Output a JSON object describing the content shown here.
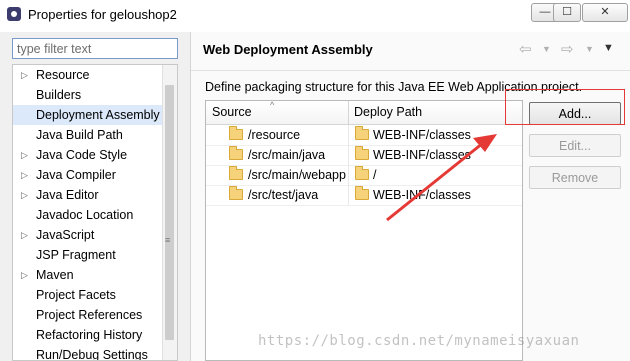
{
  "window": {
    "title": "Properties for geloushop2",
    "minimize": "—",
    "maximize": "☐",
    "close": "✕"
  },
  "filter": {
    "placeholder": "type filter text"
  },
  "tree": {
    "items": [
      {
        "label": "Resource",
        "expandable": true
      },
      {
        "label": "Builders",
        "expandable": false
      },
      {
        "label": "Deployment Assembly",
        "expandable": false,
        "selected": true
      },
      {
        "label": "Java Build Path",
        "expandable": false
      },
      {
        "label": "Java Code Style",
        "expandable": true
      },
      {
        "label": "Java Compiler",
        "expandable": true
      },
      {
        "label": "Java Editor",
        "expandable": true
      },
      {
        "label": "Javadoc Location",
        "expandable": false
      },
      {
        "label": "JavaScript",
        "expandable": true
      },
      {
        "label": "JSP Fragment",
        "expandable": false
      },
      {
        "label": "Maven",
        "expandable": true
      },
      {
        "label": "Project Facets",
        "expandable": false
      },
      {
        "label": "Project References",
        "expandable": false
      },
      {
        "label": "Refactoring History",
        "expandable": false
      },
      {
        "label": "Run/Debug Settings",
        "expandable": false
      }
    ]
  },
  "panel": {
    "title": "Web Deployment Assembly",
    "description": "Define packaging structure for this Java EE Web Application project.",
    "nav": {
      "back": "⇦",
      "forward": "⇨",
      "dropdown": "▼",
      "menu": "▼"
    }
  },
  "table": {
    "columns": [
      "Source",
      "Deploy Path"
    ],
    "rows": [
      {
        "source": "/resource",
        "deploy": "WEB-INF/classes"
      },
      {
        "source": "/src/main/java",
        "deploy": "WEB-INF/classes"
      },
      {
        "source": "/src/main/webapp",
        "deploy": "/"
      },
      {
        "source": "/src/test/java",
        "deploy": "WEB-INF/classes"
      }
    ]
  },
  "buttons": {
    "add": "Add...",
    "edit": "Edit...",
    "remove": "Remove"
  },
  "watermark": "https://blog.csdn.net/mynameisyaxuan",
  "colors": {
    "annotation": "#e53935",
    "selection": "#dbe9fb"
  }
}
